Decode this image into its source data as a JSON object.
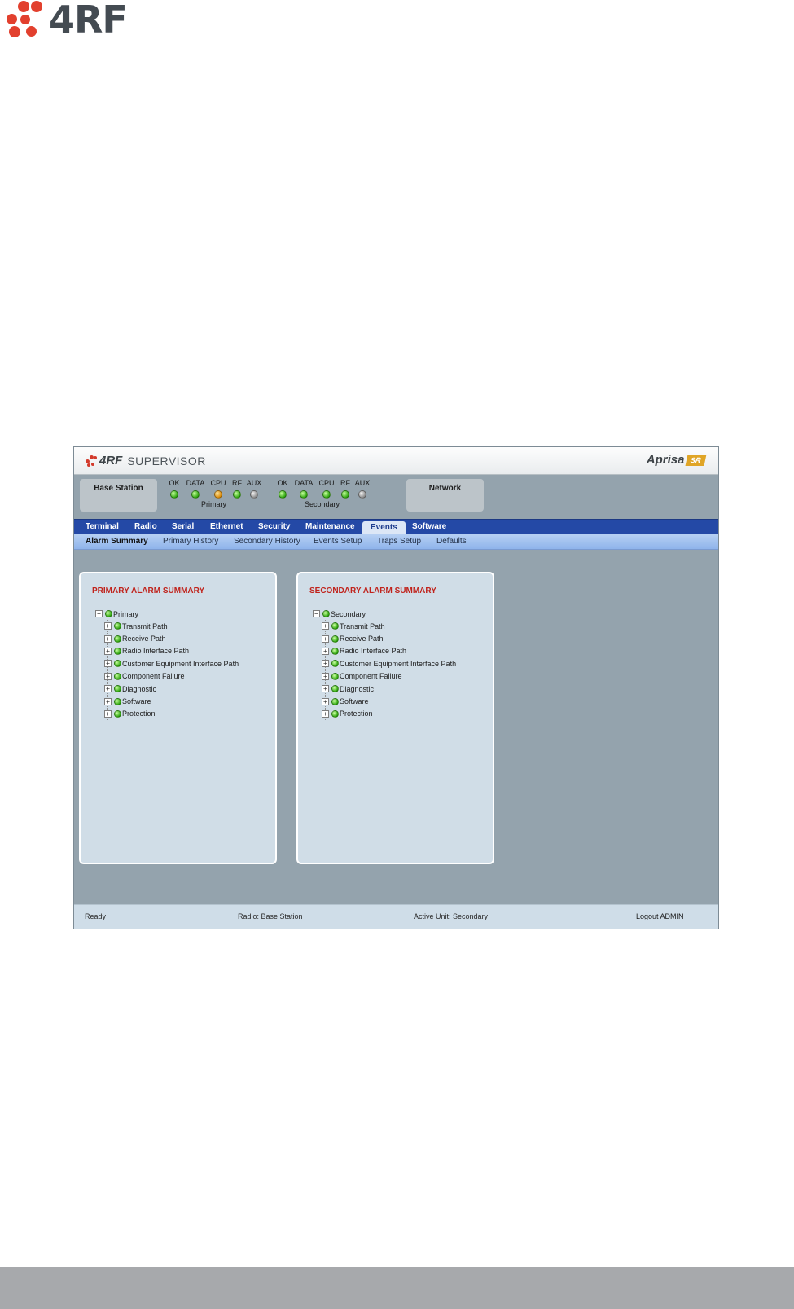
{
  "page": {
    "logo_text": "4RF"
  },
  "app": {
    "brand": "4RF",
    "product": "SUPERVISOR",
    "aprisa": "Aprisa",
    "aprisa_badge": "SR"
  },
  "status": {
    "left_box": "Base Station",
    "right_box": "Network",
    "primary": {
      "caption": "Primary",
      "leds": [
        {
          "label": "OK",
          "state": "green"
        },
        {
          "label": "DATA",
          "state": "green"
        },
        {
          "label": "CPU",
          "state": "amber"
        },
        {
          "label": "RF",
          "state": "green"
        },
        {
          "label": "AUX",
          "state": "grey"
        }
      ]
    },
    "secondary": {
      "caption": "Secondary",
      "leds": [
        {
          "label": "OK",
          "state": "green"
        },
        {
          "label": "DATA",
          "state": "green"
        },
        {
          "label": "CPU",
          "state": "green"
        },
        {
          "label": "RF",
          "state": "green"
        },
        {
          "label": "AUX",
          "state": "grey"
        }
      ]
    }
  },
  "nav": {
    "items": [
      "Terminal",
      "Radio",
      "Serial",
      "Ethernet",
      "Security",
      "Maintenance",
      "Events",
      "Software"
    ],
    "active": "Events"
  },
  "subnav": {
    "items": [
      "Alarm Summary",
      "Primary History",
      "Secondary History",
      "Events Setup",
      "Traps Setup",
      "Defaults"
    ],
    "active": "Alarm Summary"
  },
  "primary_panel": {
    "title": "PRIMARY ALARM SUMMARY",
    "root": "Primary",
    "nodes": [
      "Transmit Path",
      "Receive Path",
      "Radio Interface Path",
      "Customer Equipment Interface Path",
      "Component Failure",
      "Diagnostic",
      "Software",
      "Protection"
    ]
  },
  "secondary_panel": {
    "title": "SECONDARY ALARM SUMMARY",
    "root": "Secondary",
    "nodes": [
      "Transmit Path",
      "Receive Path",
      "Radio Interface Path",
      "Customer Equipment Interface Path",
      "Component Failure",
      "Diagnostic",
      "Software",
      "Protection"
    ]
  },
  "statusbar": {
    "ready": "Ready",
    "radio": "Radio: Base Station",
    "active_unit": "Active Unit: Secondary",
    "logout": "Logout ADMIN"
  },
  "colors": {
    "nav_bg": "#2449a6",
    "alarm_title": "#c0231c",
    "led_green": "#2fa60f",
    "led_amber": "#d98a09"
  }
}
